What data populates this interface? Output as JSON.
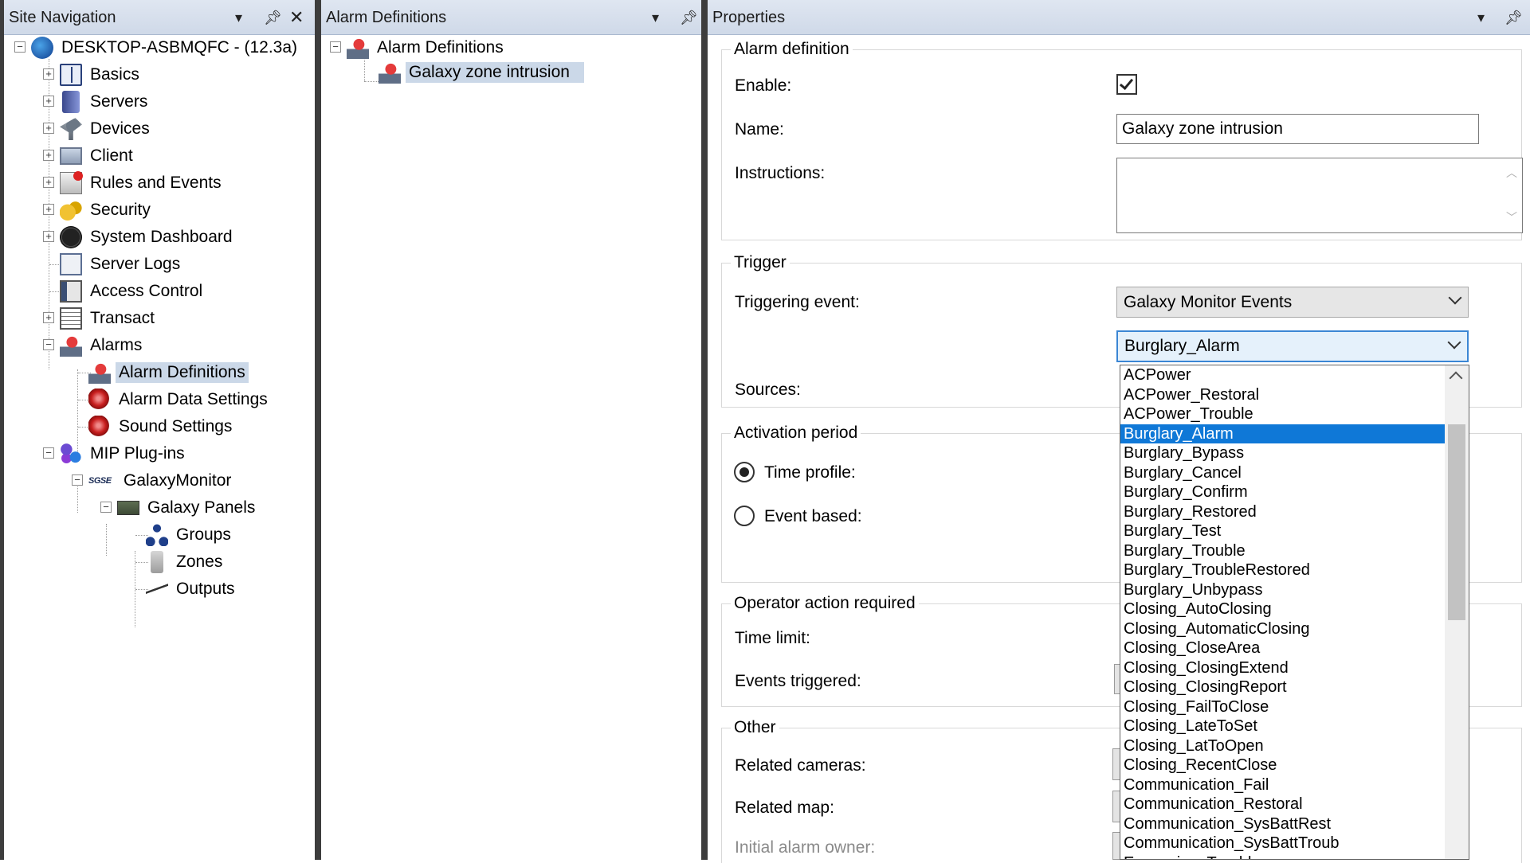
{
  "site_nav": {
    "title": "Site Navigation",
    "root": "DESKTOP-ASBMQFC - (12.3a)",
    "items": [
      "Basics",
      "Servers",
      "Devices",
      "Client",
      "Rules and Events",
      "Security",
      "System Dashboard",
      "Server Logs",
      "Access Control",
      "Transact",
      "Alarms"
    ],
    "alarm_children": [
      "Alarm Definitions",
      "Alarm Data Settings",
      "Sound Settings"
    ],
    "mip": "MIP Plug-ins",
    "galaxy_monitor": "GalaxyMonitor",
    "sgse": "SGSE",
    "galaxy_panels": "Galaxy Panels",
    "panel_children": [
      "Groups",
      "Zones",
      "Outputs"
    ]
  },
  "alarm_defs": {
    "title": "Alarm Definitions",
    "root": "Alarm Definitions",
    "item": "Galaxy zone intrusion"
  },
  "properties": {
    "title": "Properties",
    "alarm_definition": {
      "title": "Alarm definition",
      "enable_label": "Enable:",
      "enabled": true,
      "name_label": "Name:",
      "name_value": "Galaxy zone intrusion",
      "instructions_label": "Instructions:"
    },
    "trigger": {
      "title": "Trigger",
      "event_label": "Triggering event:",
      "event_value": "Galaxy Monitor Events",
      "sub_value": "Burglary_Alarm",
      "sources_label": "Sources:"
    },
    "activation": {
      "title": "Activation period",
      "time_profile": "Time profile:",
      "event_based": "Event based:",
      "selected": "time_profile"
    },
    "operator": {
      "title": "Operator action required",
      "time_limit": "Time limit:",
      "events_triggered": "Events triggered:"
    },
    "other": {
      "title": "Other",
      "related_cameras": "Related cameras:",
      "related_map": "Related map:",
      "initial_owner": "Initial alarm owner:"
    }
  },
  "dropdown": {
    "selected": "Burglary_Alarm",
    "options": [
      "ACPower",
      "ACPower_Restoral",
      "ACPower_Trouble",
      "Burglary_Alarm",
      "Burglary_Bypass",
      "Burglary_Cancel",
      "Burglary_Confirm",
      "Burglary_Restored",
      "Burglary_Test",
      "Burglary_Trouble",
      "Burglary_TroubleRestored",
      "Burglary_Unbypass",
      "Closing_AutoClosing",
      "Closing_AutomaticClosing",
      "Closing_CloseArea",
      "Closing_ClosingExtend",
      "Closing_ClosingReport",
      "Closing_FailToClose",
      "Closing_LateToSet",
      "Closing_LatToOpen",
      "Closing_RecentClose",
      "Communication_Fail",
      "Communication_Restoral",
      "Communication_SysBattRest",
      "Communication_SysBattTroub",
      "Expansion_Trouble"
    ]
  },
  "colors": {
    "selection_highlight": "#0f78d7",
    "tree_selection": "#cbd8e8",
    "splitter": "#3d3d3d"
  }
}
